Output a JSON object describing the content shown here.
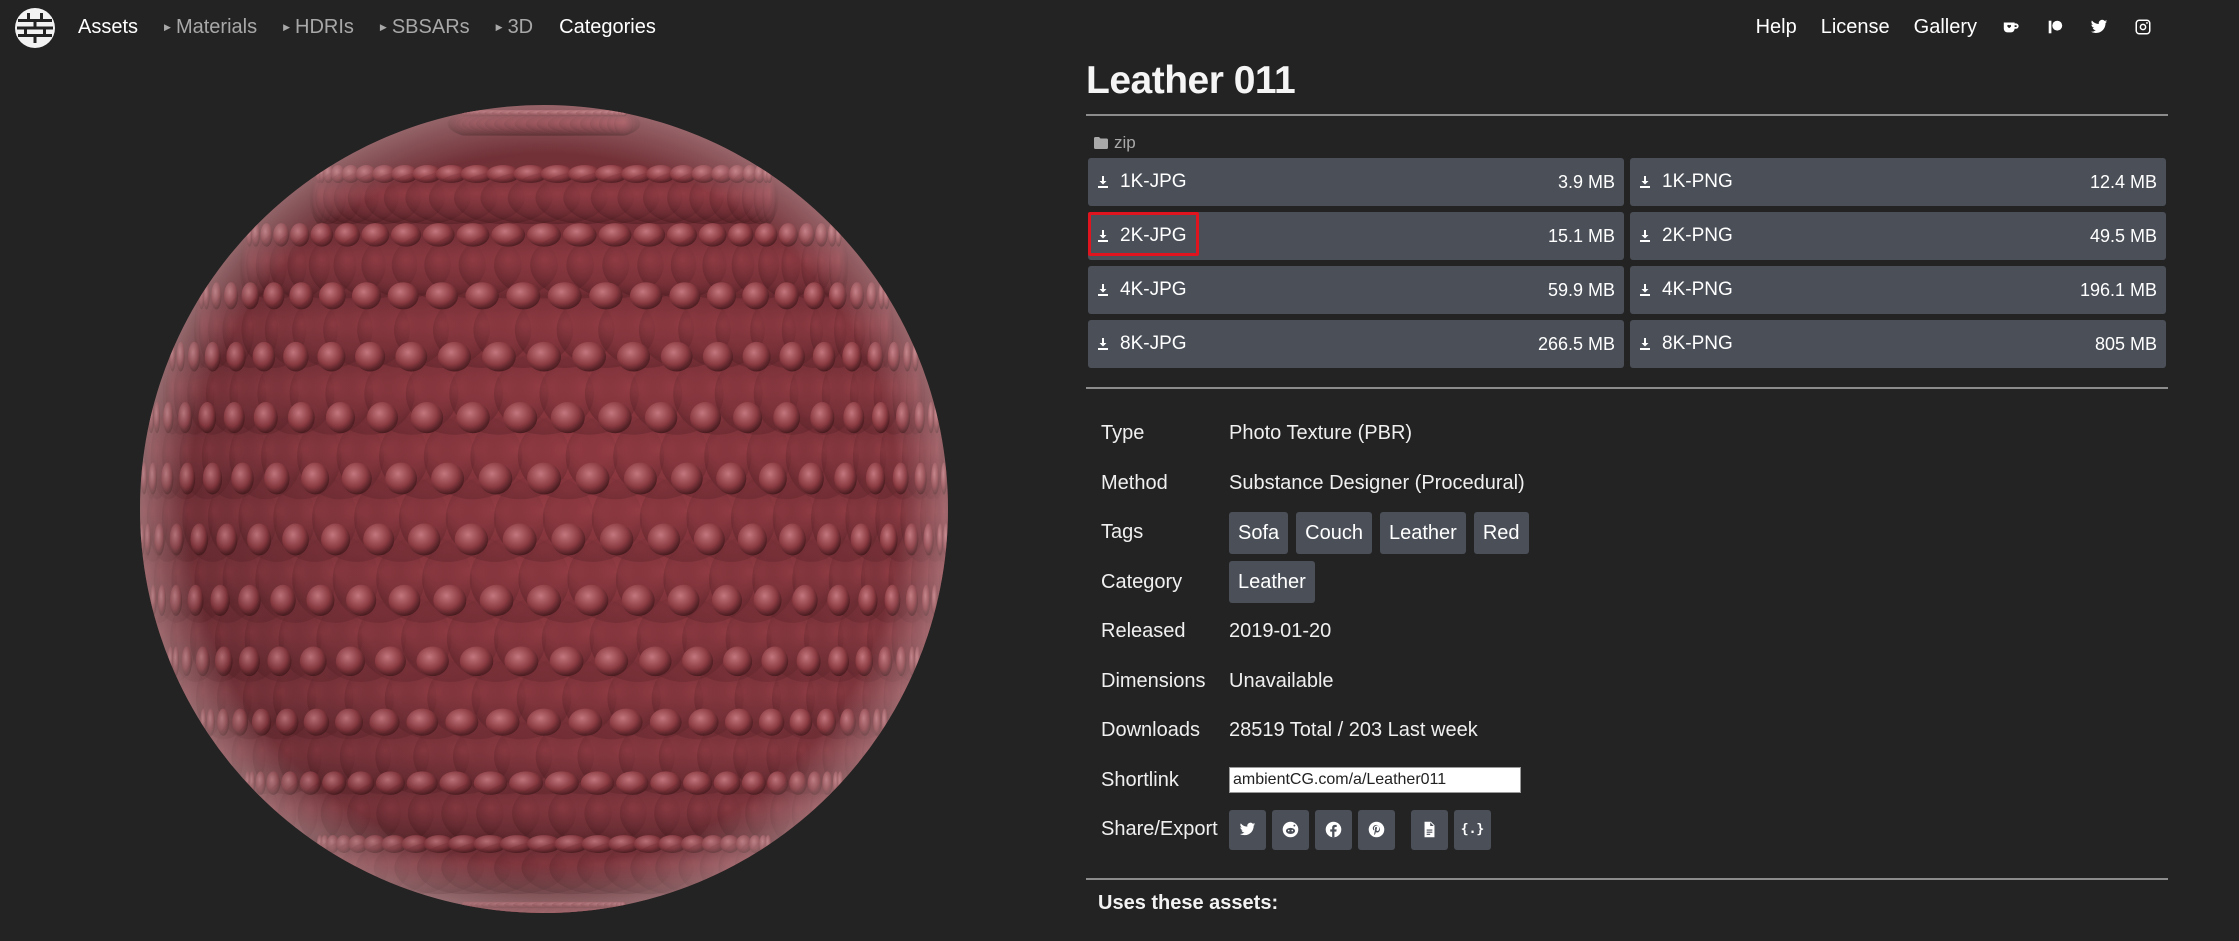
{
  "nav": {
    "assets": "Assets",
    "materials": "Materials",
    "hdris": "HDRIs",
    "sbsars": "SBSARs",
    "three_d": "3D",
    "categories": "Categories",
    "help": "Help",
    "license": "License",
    "gallery": "Gallery",
    "social_icons": [
      "kofi-icon",
      "patreon-icon",
      "twitter-icon",
      "instagram-icon"
    ]
  },
  "asset": {
    "title": "Leather 011",
    "zip_label": "zip",
    "downloads": [
      {
        "label": "1K-JPG",
        "size": "3.9 MB"
      },
      {
        "label": "1K-PNG",
        "size": "12.4 MB"
      },
      {
        "label": "2K-JPG",
        "size": "15.1 MB"
      },
      {
        "label": "2K-PNG",
        "size": "49.5 MB"
      },
      {
        "label": "4K-JPG",
        "size": "59.9 MB"
      },
      {
        "label": "4K-PNG",
        "size": "196.1 MB"
      },
      {
        "label": "8K-JPG",
        "size": "266.5 MB"
      },
      {
        "label": "8K-PNG",
        "size": "805 MB"
      }
    ],
    "highlighted_download": "2K-JPG"
  },
  "info": {
    "type_label": "Type",
    "type_value": "Photo Texture (PBR)",
    "method_label": "Method",
    "method_value": "Substance Designer (Procedural)",
    "tags_label": "Tags",
    "tags": [
      "Sofa",
      "Couch",
      "Leather",
      "Red"
    ],
    "category_label": "Category",
    "category_value": "Leather",
    "released_label": "Released",
    "released_value": "2019-01-20",
    "dimensions_label": "Dimensions",
    "dimensions_value": "Unavailable",
    "downloads_label": "Downloads",
    "downloads_value": "28519 Total / 203 Last week",
    "shortlink_label": "Shortlink",
    "shortlink_value": "ambientCG.com/a/Leather011",
    "share_label": "Share/Export",
    "share_icons": [
      "twitter-icon",
      "reddit-icon",
      "facebook-icon",
      "pinterest-icon",
      "file-icon",
      "json-icon"
    ]
  },
  "uses_heading": "Uses these assets:",
  "colors": {
    "background": "#232323",
    "button": "#4a4f58",
    "highlight": "#e0141e",
    "leather": "#8a3c43"
  }
}
